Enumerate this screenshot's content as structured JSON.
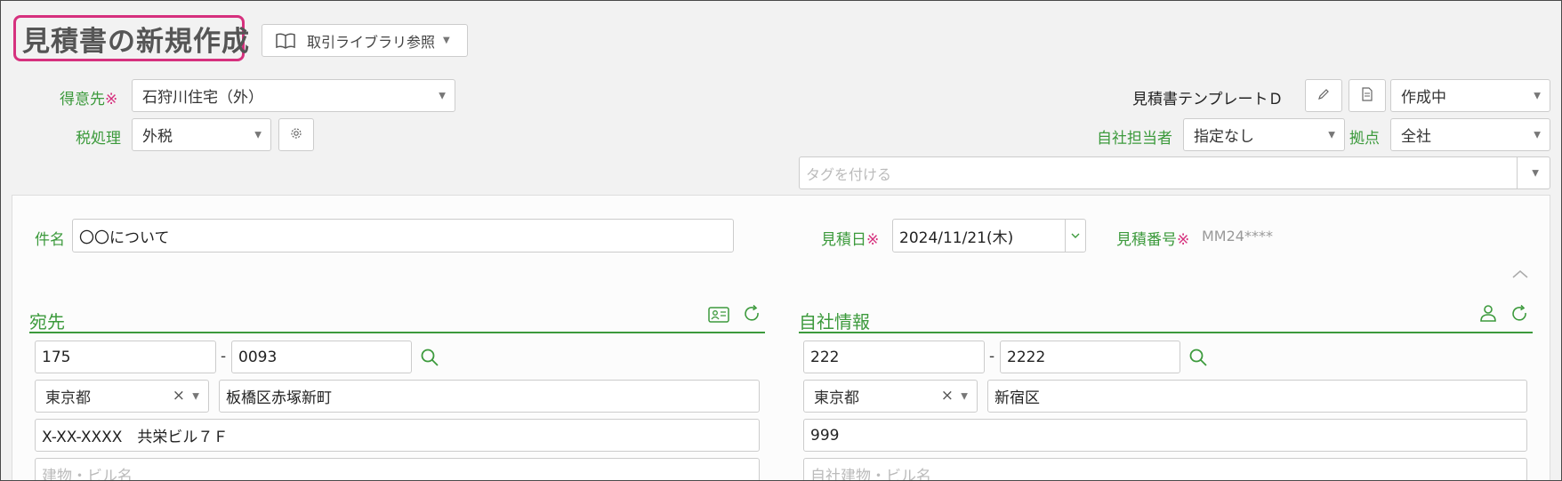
{
  "header": {
    "title": "見積書の新規作成",
    "library_button": "取引ライブラリ参照"
  },
  "top_form": {
    "customer_label": "得意先",
    "required_mark": "※",
    "customer_value": "石狩川住宅（外）",
    "tax_label": "税処理",
    "tax_value": "外税",
    "template_name": "見積書テンプレートＤ",
    "status_value": "作成中",
    "staff_label": "自社担当者",
    "staff_value": "指定なし",
    "base_label": "拠点",
    "base_value": "全社",
    "tag_placeholder": "タグを付ける"
  },
  "details": {
    "subject_label": "件名",
    "subject_value": "〇〇について",
    "date_label": "見積日",
    "date_value": "2024/11/21(木)",
    "number_label": "見積番号",
    "number_value": "MM24****"
  },
  "recipient": {
    "title": "宛先",
    "zip1": "175",
    "zip_sep": "-",
    "zip2": "0093",
    "prefecture": "東京都",
    "clear": "×",
    "city": "板橋区赤塚新町",
    "address": "X-XX-XXXX　共栄ビル７Ｆ",
    "building_placeholder": "建物・ビル名"
  },
  "company": {
    "title": "自社情報",
    "zip1": "222",
    "zip_sep": "-",
    "zip2": "2222",
    "prefecture": "東京都",
    "clear": "×",
    "city": "新宿区",
    "address": "999",
    "building_placeholder": "自社建物・ビル名"
  },
  "colors": {
    "accent_green": "#3c9a3c",
    "highlight_pink": "#d6317e"
  }
}
